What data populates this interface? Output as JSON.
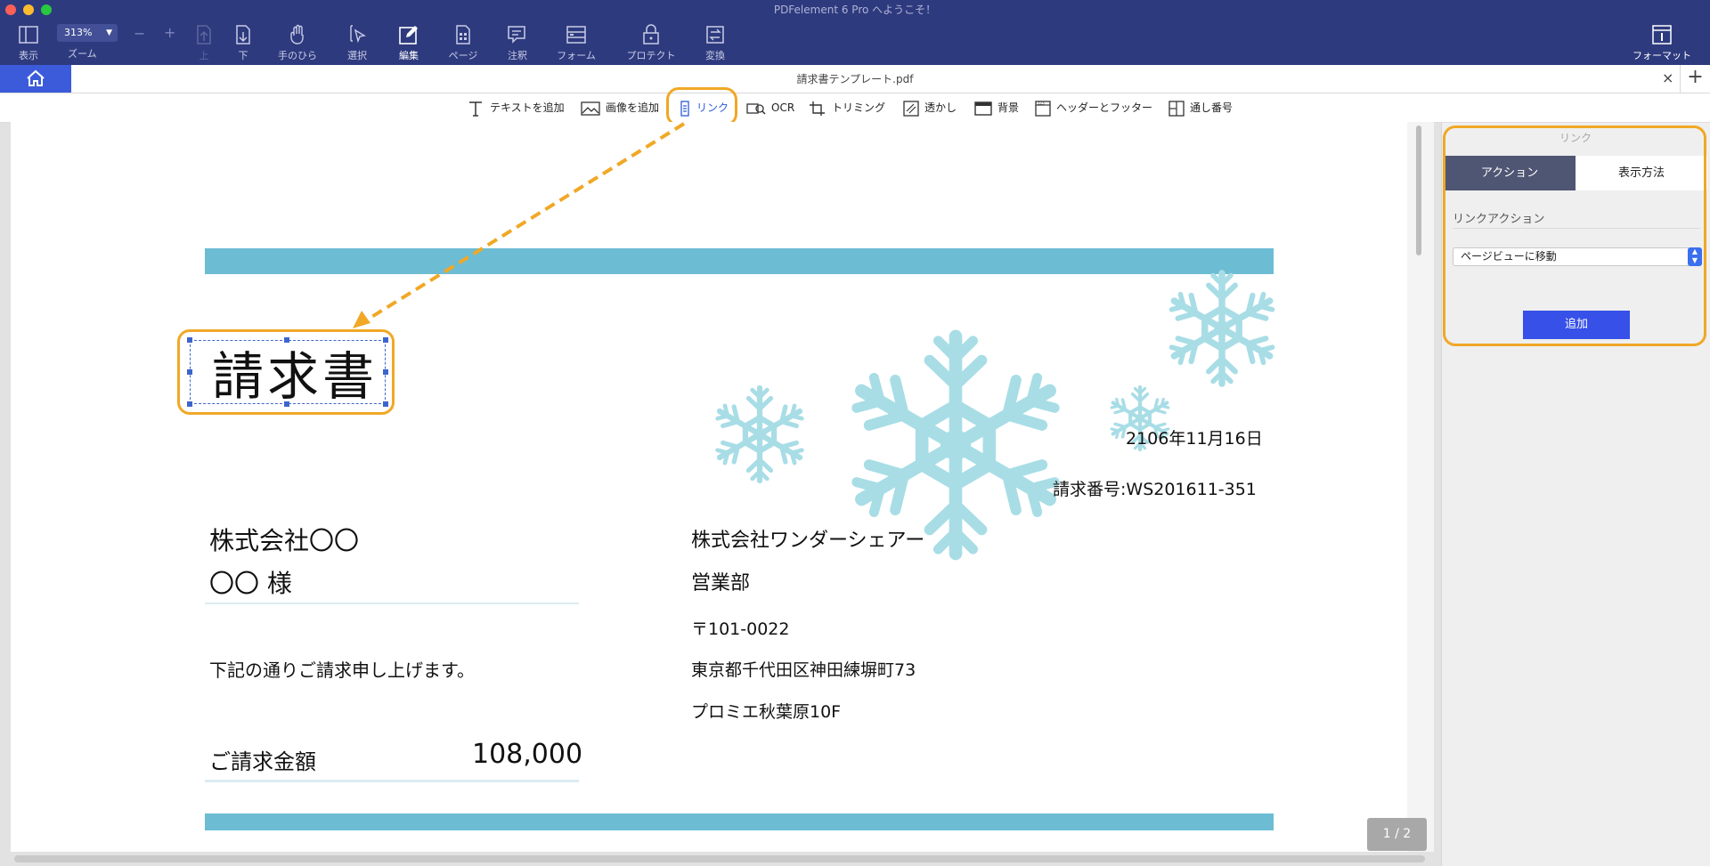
{
  "app": {
    "title": "PDFelement 6 Pro へようこそ！"
  },
  "toolbar": {
    "zoom_value": "313%",
    "zoom_minus": "−",
    "zoom_plus": "+",
    "items": [
      {
        "label": "表示"
      },
      {
        "label": "ズーム"
      },
      {
        "label": "上"
      },
      {
        "label": "下"
      },
      {
        "label": "手のひら"
      },
      {
        "label": "選択"
      },
      {
        "label": "編集"
      },
      {
        "label": "ページ"
      },
      {
        "label": "注釈"
      },
      {
        "label": "フォーム"
      },
      {
        "label": "プロテクト"
      },
      {
        "label": "変換"
      },
      {
        "label": "フォーマット"
      }
    ]
  },
  "tab": {
    "title": "請求書テンプレート.pdf",
    "close": "×",
    "add": "+"
  },
  "edit_toolbar": {
    "items": [
      {
        "label": "テキストを追加"
      },
      {
        "label": "画像を追加"
      },
      {
        "label": "リンク"
      },
      {
        "label": "OCR"
      },
      {
        "label": "トリミング"
      },
      {
        "label": "透かし"
      },
      {
        "label": "背景"
      },
      {
        "label": "ヘッダーとフッター"
      },
      {
        "label": "通し番号"
      }
    ]
  },
  "document": {
    "title": "請求書",
    "date": "2106年11月16日",
    "invoice_number": "請求番号:WS201611-351",
    "recipient_company": "株式会社〇〇",
    "recipient_name": "〇〇 様",
    "message": "下記の通りご請求申し上げます。",
    "amount_label": "ご請求金額",
    "amount_value": "108,000",
    "sender_company": "株式会社ワンダーシェアー",
    "sender_dept": "営業部",
    "sender_zip": "〒101-0022",
    "sender_address": "東京都千代田区神田練塀町73",
    "sender_building": "プロミエ秋葉原10F",
    "page_indicator": "1 / 2"
  },
  "panel": {
    "header": "リンク",
    "tabs": [
      {
        "label": "アクション"
      },
      {
        "label": "表示方法"
      }
    ],
    "section_label": "リンクアクション",
    "select_value": "ページビューに移動",
    "add_button": "追加"
  },
  "colors": {
    "toolbar_bg": "#2e3a7e",
    "accent": "#3b5bdb",
    "highlight": "#f0a826",
    "band": "#6cbcd4",
    "snowflake": "#a8dde6"
  }
}
